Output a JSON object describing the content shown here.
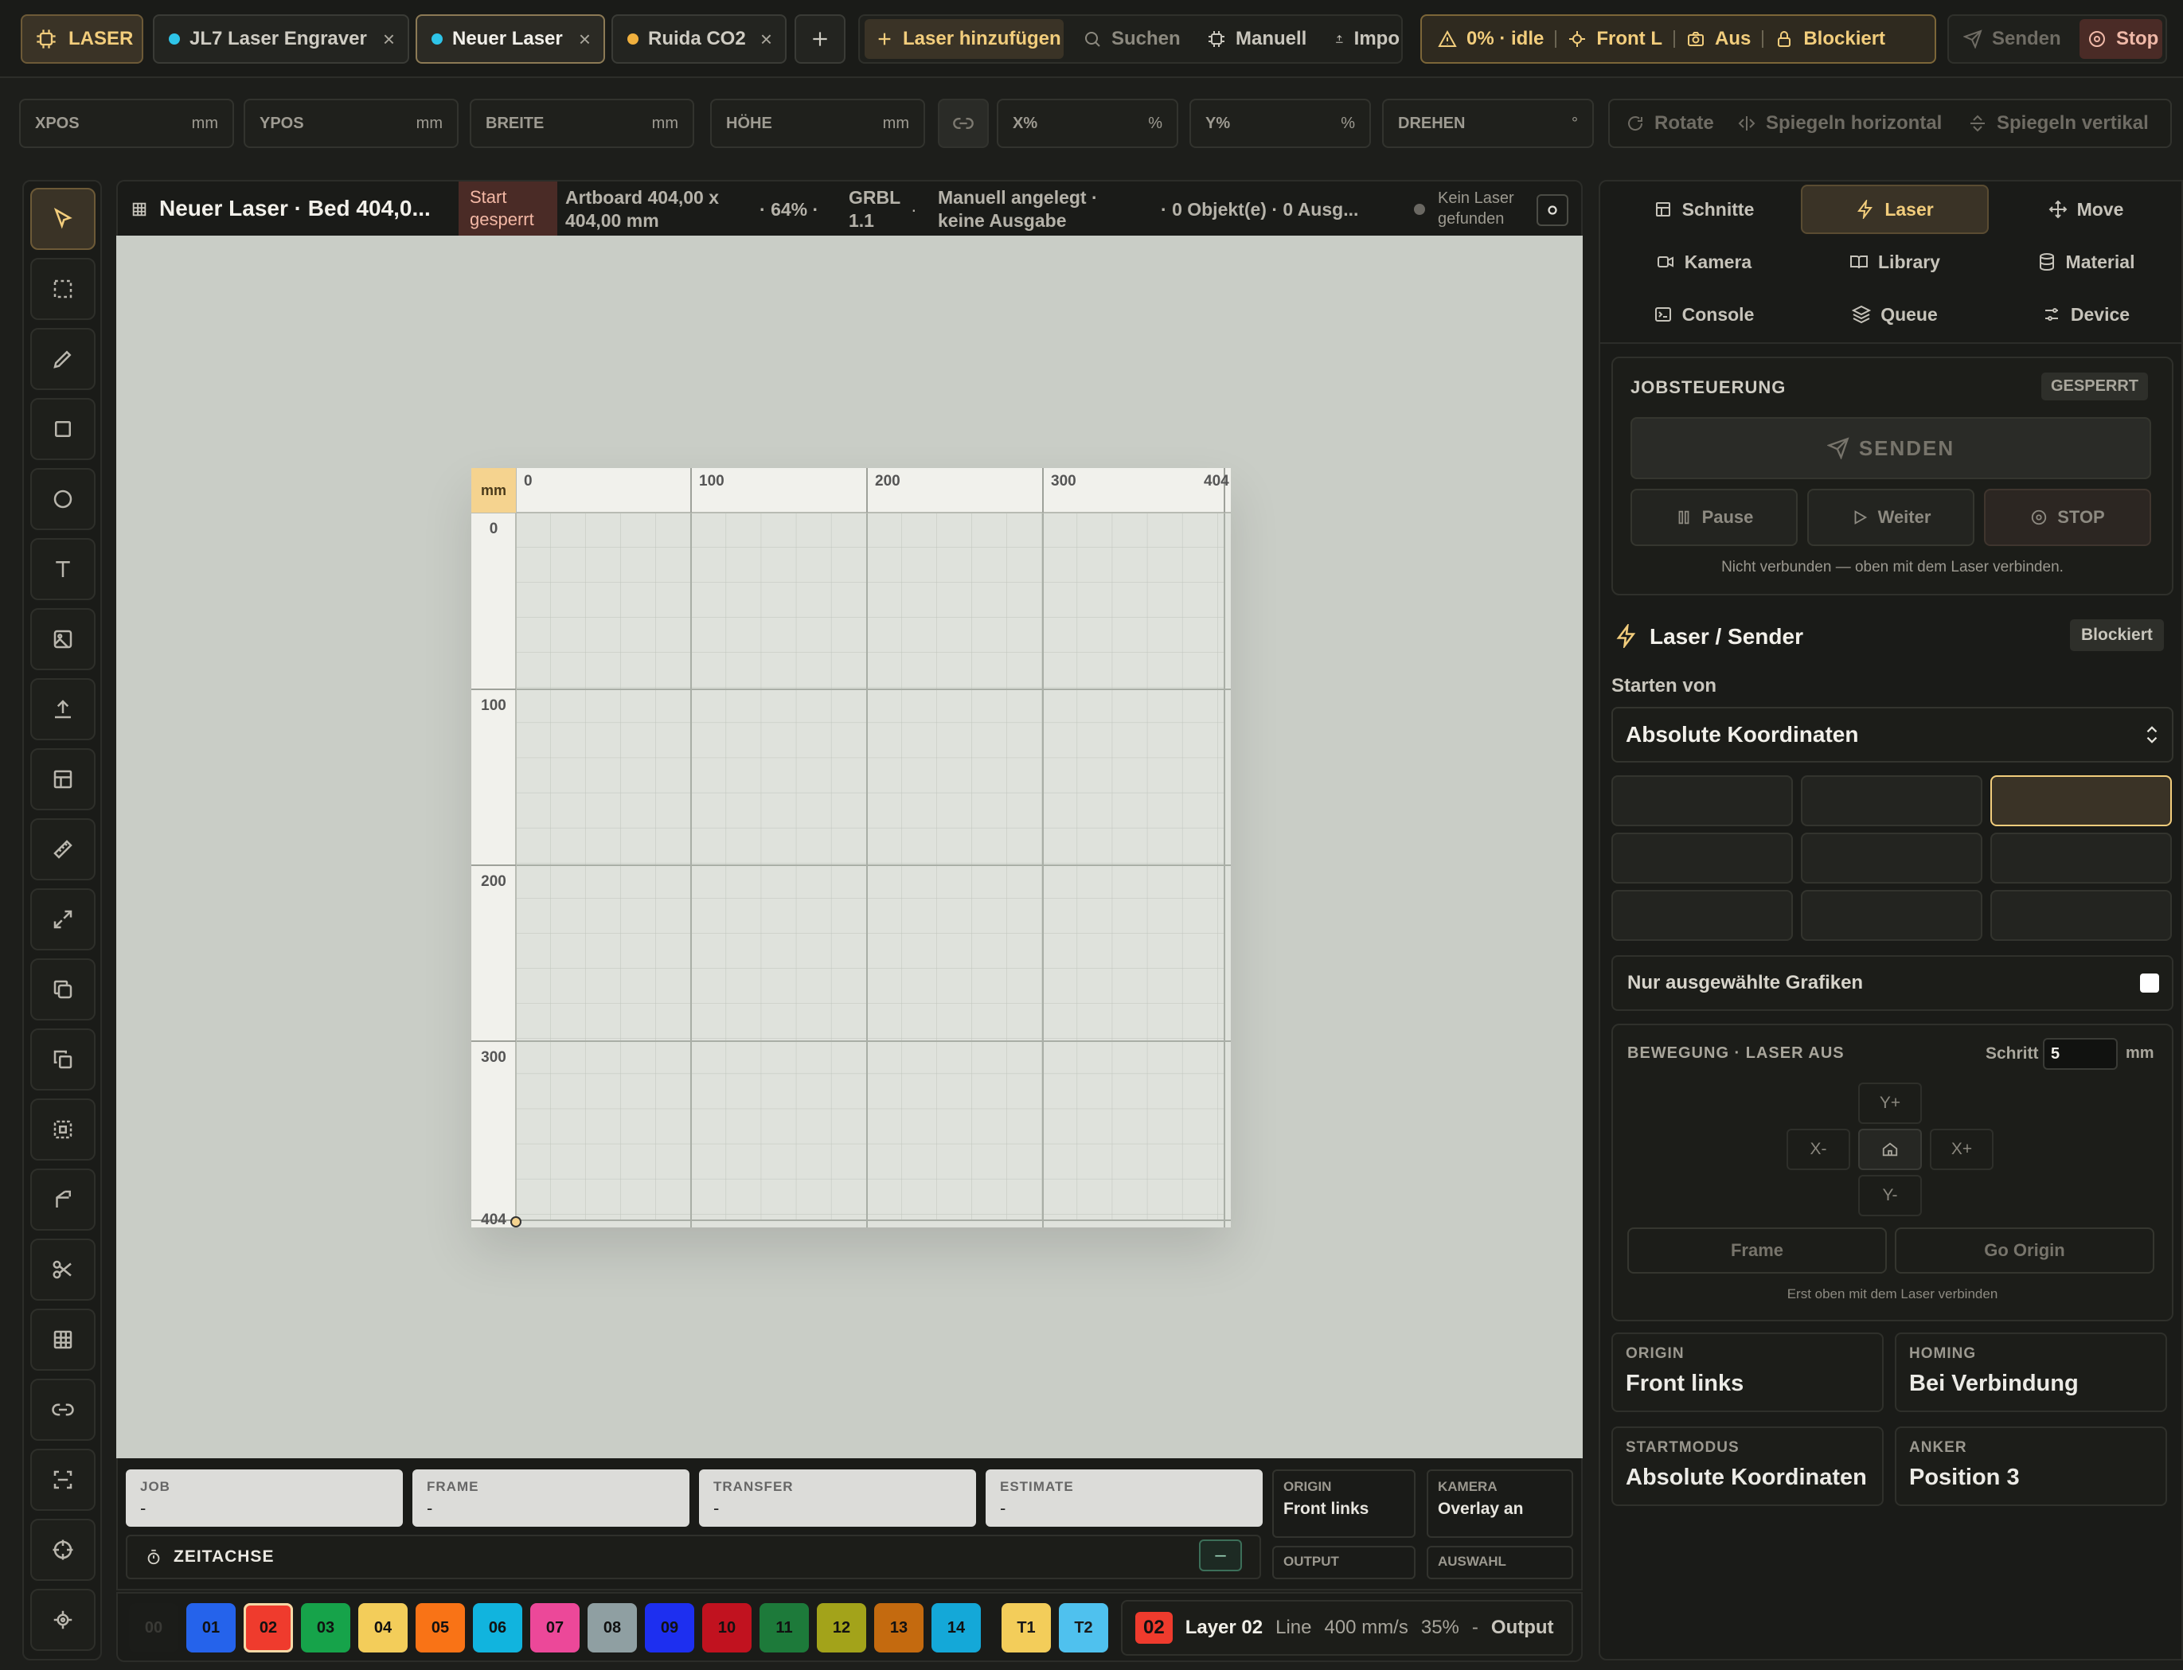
{
  "topbar": {
    "brand": "LASER",
    "tabs": [
      {
        "label": "JL7 Laser Engraver",
        "dot": "#2ec4e8"
      },
      {
        "label": "Neuer Laser",
        "dot": "#2ec4e8"
      },
      {
        "label": "Ruida CO2",
        "dot": "#f0b03e"
      }
    ],
    "add_laser": "Laser hinzufügen",
    "search": "Suchen",
    "manual": "Manuell",
    "import": "Impo",
    "status": {
      "progress": "0% · idle",
      "origin": "Front L",
      "camera": "Aus",
      "lock": "Blockiert"
    },
    "send": "Senden",
    "stop": "Stop"
  },
  "transform": {
    "xpos": "XPOS",
    "ypos": "YPOS",
    "width": "BREITE",
    "height": "HÖHE",
    "unit_mm": "mm",
    "xpct": "X%",
    "ypct": "Y%",
    "unit_pct": "%",
    "rotate": "DREHEN",
    "unit_deg": "°",
    "rotate_btn": "Rotate",
    "flip_h": "Spiegeln horizontal",
    "flip_v": "Spiegeln vertikal"
  },
  "canvas_header": {
    "title": "Neuer Laser · Bed 404,0...",
    "start_locked_1": "Start",
    "start_locked_2": "gesperrt",
    "artboard_1": "Artboard 404,00 x",
    "artboard_2": "404,00 mm",
    "zoom": "64%",
    "firmware_1": "GRBL",
    "firmware_2": "1.1",
    "mode_1": "Manuell angelegt ·",
    "mode_2": "keine Ausgabe",
    "objects": "0 Objekt(e) · 0 Ausg...",
    "no_laser_1": "Kein Laser",
    "no_laser_2": "gefunden"
  },
  "ruler": {
    "unit": "mm",
    "x_ticks": [
      "0",
      "100",
      "200",
      "300",
      "404"
    ],
    "y_ticks": [
      "0",
      "100",
      "200",
      "300",
      "404"
    ]
  },
  "bottom": {
    "stats": [
      {
        "label": "JOB",
        "value": "-"
      },
      {
        "label": "FRAME",
        "value": "-"
      },
      {
        "label": "TRANSFER",
        "value": "-"
      },
      {
        "label": "ESTIMATE",
        "value": "-"
      }
    ],
    "origin": {
      "label": "ORIGIN",
      "value": "Front links"
    },
    "camera": {
      "label": "KAMERA",
      "value": "Overlay an"
    },
    "output": {
      "label": "OUTPUT"
    },
    "selection": {
      "label": "AUSWAHL"
    },
    "timeline": "ZEITACHSE",
    "timeline_btn": "–"
  },
  "layers": [
    {
      "id": "00",
      "color": "#1b1c19",
      "text": "#3a3a36"
    },
    {
      "id": "01",
      "color": "#2563eb",
      "text": "#111"
    },
    {
      "id": "02",
      "color": "#ef3b2d",
      "text": "#111"
    },
    {
      "id": "03",
      "color": "#16a34a",
      "text": "#111"
    },
    {
      "id": "04",
      "color": "#f3cd5a",
      "text": "#111"
    },
    {
      "id": "05",
      "color": "#f97316",
      "text": "#111"
    },
    {
      "id": "06",
      "color": "#11b4de",
      "text": "#111"
    },
    {
      "id": "07",
      "color": "#ec4899",
      "text": "#111"
    },
    {
      "id": "08",
      "color": "#8f9fa2",
      "text": "#111"
    },
    {
      "id": "09",
      "color": "#1d2ff0",
      "text": "#111"
    },
    {
      "id": "10",
      "color": "#c1121f",
      "text": "#111"
    },
    {
      "id": "11",
      "color": "#1d7a3a",
      "text": "#111"
    },
    {
      "id": "12",
      "color": "#a3a31a",
      "text": "#111"
    },
    {
      "id": "13",
      "color": "#c46a0f",
      "text": "#111"
    },
    {
      "id": "14",
      "color": "#14a8d8",
      "text": "#111"
    }
  ],
  "tool_layers": [
    {
      "id": "T1",
      "color": "#f3cd5a"
    },
    {
      "id": "T2",
      "color": "#4fc1ee"
    }
  ],
  "layer_info": {
    "badge": "02",
    "name": "Layer 02",
    "mode": "Line",
    "speed": "400 mm/s",
    "power": "35%",
    "dash": "-",
    "output": "Output"
  },
  "panel": {
    "tabs": [
      "Schnitte",
      "Laser",
      "Move",
      "Kamera",
      "Library",
      "Material",
      "Console",
      "Queue",
      "Device"
    ],
    "job": {
      "title": "JOBSTEUERUNG",
      "badge": "GESPERRT",
      "send": "SENDEN",
      "pause": "Pause",
      "resume": "Weiter",
      "stop": "STOP",
      "note": "Nicht verbunden — oben mit dem Laser verbinden."
    },
    "laser_sender": {
      "title": "Laser / Sender",
      "badge": "Blockiert"
    },
    "start_from": {
      "label": "Starten von",
      "value": "Absolute Koordinaten"
    },
    "selected_only": "Nur ausgewählte Grafiken",
    "motion": {
      "title": "BEWEGUNG · LASER AUS",
      "step_label": "Schritt",
      "step_value": "5",
      "step_unit": "mm",
      "yplus": "Y+",
      "yminus": "Y-",
      "xminus": "X-",
      "xplus": "X+",
      "frame": "Frame",
      "go_origin": "Go Origin",
      "note": "Erst oben mit dem Laser verbinden"
    },
    "info": [
      {
        "label": "ORIGIN",
        "value": "Front links"
      },
      {
        "label": "HOMING",
        "value": "Bei Verbindung"
      },
      {
        "label": "STARTMODUS",
        "value": "Absolute Koordinaten"
      },
      {
        "label": "ANKER",
        "value": "Position 3"
      }
    ]
  }
}
